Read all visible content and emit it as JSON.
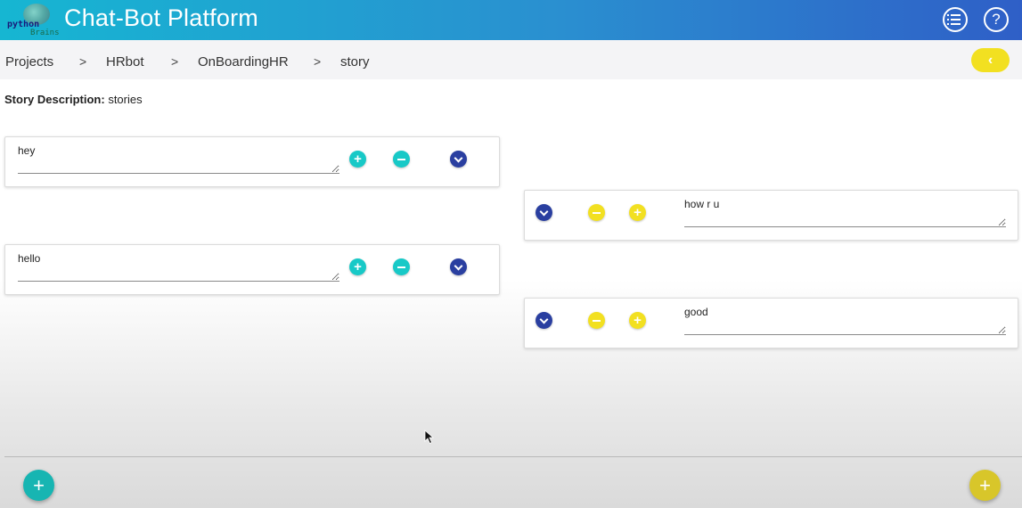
{
  "header": {
    "logo_text_top": "python",
    "logo_text_bottom": "Brains",
    "title": "Chat-Bot Platform",
    "menu_icon": "list-menu-icon",
    "help_icon": "help-icon",
    "help_glyph": "?"
  },
  "breadcrumb": {
    "items": [
      "Projects",
      "HRbot",
      "OnBoardingHR",
      "story"
    ],
    "separator": ">"
  },
  "back_button": {
    "glyph": "‹"
  },
  "story": {
    "description_label": "Story Description:",
    "description_value": "stories"
  },
  "user_messages": [
    {
      "text": "hey"
    },
    {
      "text": "hello"
    }
  ],
  "bot_messages": [
    {
      "text": "how r u"
    },
    {
      "text": "good"
    }
  ],
  "fab": {
    "glyph": "+"
  },
  "colors": {
    "teal": "#18c9c7",
    "yellow": "#f2e021",
    "navy": "#2a3fa0"
  }
}
